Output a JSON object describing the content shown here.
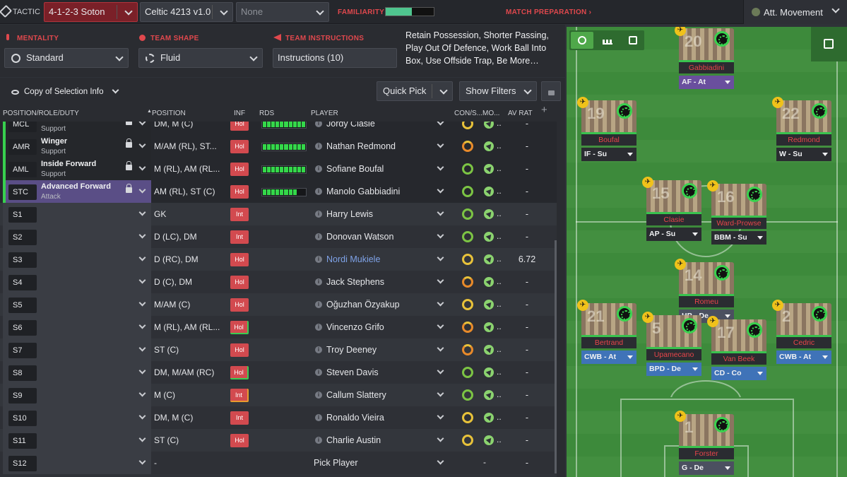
{
  "topbar": {
    "tactic_label": "TACTIC",
    "tactic_value": "4-1-2-3 Soton",
    "tactic2_value": "Celtic 4213 v1.0",
    "tactic3_value": "None",
    "familiarity_label": "FAMILIARITY",
    "familiarity_level": 0.55,
    "match_prep_label": "MATCH PREPARATION ›",
    "movement_label": "Att. Movement"
  },
  "settings": {
    "mentality_label": "MENTALITY",
    "mentality_value": "Standard",
    "shape_label": "TEAM SHAPE",
    "shape_value": "Fluid",
    "instructions_label": "TEAM INSTRUCTIONS",
    "instructions_value": "Instructions (10)",
    "instructions_summary": "Retain Possession, Shorter Passing, Play Out Of Defence, Work Ball Into Box, Use Offside Trap, Be More…"
  },
  "toolbar": {
    "selection_info": "Copy of Selection Info",
    "quick_pick": "Quick Pick",
    "show_filters": "Show Filters",
    "plus": "+"
  },
  "headers": {
    "position_role_duty": "POSITION/ROLE/DUTY",
    "position": "POSITION",
    "inf": "INF",
    "rds": "RDS",
    "player": "PLAYER",
    "con": "CON/S...",
    "mo": "MO...",
    "av_rat": "AV RAT"
  },
  "rows": [
    {
      "slot": "MCL",
      "role": "",
      "duty": "Support",
      "pos": "DM, M (C)",
      "inf": "Hol",
      "rds": 10,
      "player": "Jordy Clasie",
      "rat": "-"
    },
    {
      "slot": "AMR",
      "role": "Winger",
      "duty": "Support",
      "pos": "M/AM (RL), ST...",
      "inf": "Hol",
      "rds": 10,
      "player": "Nathan Redmond",
      "rat": "-"
    },
    {
      "slot": "AML",
      "role": "Inside Forward",
      "duty": "Support",
      "pos": "M (RL), AM (RL...",
      "inf": "Hol",
      "rds": 10,
      "player": "Sofiane Boufal",
      "rat": "-"
    },
    {
      "slot": "STC",
      "role": "Advanced Forward",
      "duty": "Attack",
      "pos": "AM (RL), ST (C)",
      "inf": "Hol",
      "rds": 8,
      "player": "Manolo Gabbiadini",
      "rat": "-"
    },
    {
      "slot": "S1",
      "pos": "GK",
      "inf": "Int",
      "player": "Harry Lewis",
      "rat": "-"
    },
    {
      "slot": "S2",
      "pos": "D (LC), DM",
      "inf": "Int",
      "player": "Donovan Watson",
      "rat": "-"
    },
    {
      "slot": "S3",
      "pos": "D (RC), DM",
      "inf": "Hol",
      "player": "Nordi Mukiele",
      "rat": "6.72"
    },
    {
      "slot": "S4",
      "pos": "D (C), DM",
      "inf": "Hol",
      "player": "Jack Stephens",
      "rat": "-"
    },
    {
      "slot": "S5",
      "pos": "M/AM (C)",
      "inf": "Hol",
      "player": "Oğuzhan Özyakup",
      "rat": "-"
    },
    {
      "slot": "S6",
      "pos": "M (RL), AM (RL...",
      "inf": "Hol",
      "player": "Vincenzo Grifo",
      "rat": "-"
    },
    {
      "slot": "S7",
      "pos": "ST (C)",
      "inf": "Hol",
      "player": "Troy Deeney",
      "rat": "-"
    },
    {
      "slot": "S8",
      "pos": "DM, M/AM (RC)",
      "inf": "Hol",
      "player": "Steven Davis",
      "rat": "-"
    },
    {
      "slot": "S9",
      "pos": "M (C)",
      "inf": "Int",
      "player": "Callum Slattery",
      "rat": "-"
    },
    {
      "slot": "S10",
      "pos": "DM, M (C)",
      "inf": "Int",
      "player": "Ronaldo Vieira",
      "rat": "-"
    },
    {
      "slot": "S11",
      "pos": "ST (C)",
      "inf": "Hol",
      "player": "Charlie Austin",
      "rat": "-"
    },
    {
      "slot": "S12",
      "pos": "-",
      "player": "Pick Player",
      "con": "-",
      "rat": "-"
    }
  ],
  "pitch": {
    "players": [
      {
        "num": "20",
        "name": "Gabbiadini",
        "role": "AF - At"
      },
      {
        "num": "19",
        "name": "Boufal",
        "role": "IF - Su"
      },
      {
        "num": "22",
        "name": "Redmond",
        "role": "W - Su"
      },
      {
        "num": "15",
        "name": "Clasie",
        "role": "AP - Su"
      },
      {
        "num": "16",
        "name": "Ward-Prowse",
        "role": "BBM - Su"
      },
      {
        "num": "14",
        "name": "Romeu",
        "role": "HB - De"
      },
      {
        "num": "21",
        "name": "Bertrand",
        "role": "CWB - At"
      },
      {
        "num": "5",
        "name": "Upamecano",
        "role": "BPD - De"
      },
      {
        "num": "17",
        "name": "Van Beek",
        "role": "CD - Co"
      },
      {
        "num": "2",
        "name": "Cedric",
        "role": "CWB - At"
      },
      {
        "num": "1",
        "name": "Forster",
        "role": "G - De"
      }
    ]
  }
}
